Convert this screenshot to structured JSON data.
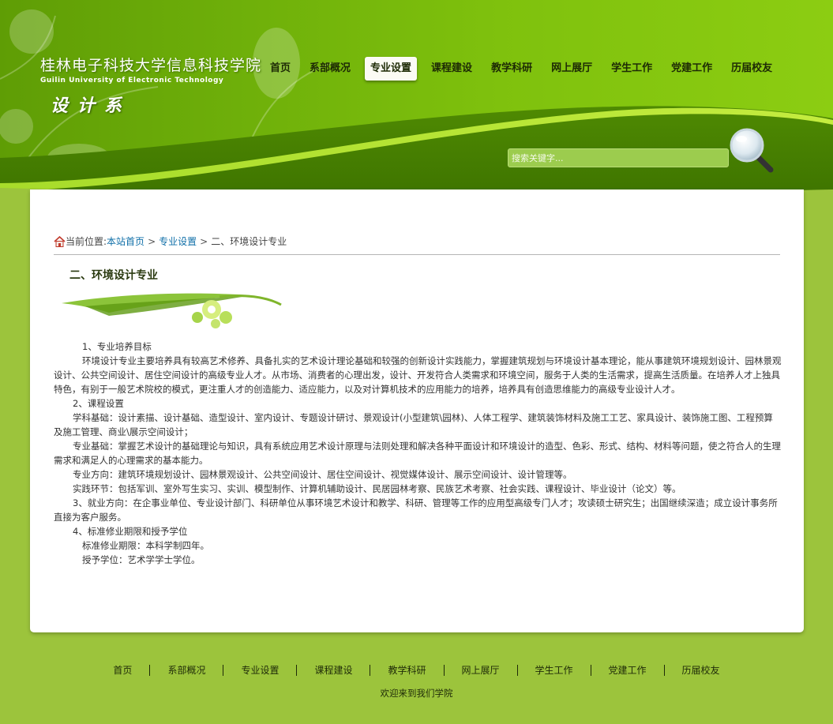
{
  "header": {
    "school_name": "桂林电子科技大学信息科技学院",
    "school_name_en": "Guilin University of Electronic Technology",
    "department": "设计系"
  },
  "nav": {
    "items": [
      {
        "label": "首页",
        "active": false
      },
      {
        "label": "系部概况",
        "active": false
      },
      {
        "label": "专业设置",
        "active": true
      },
      {
        "label": "课程建设",
        "active": false
      },
      {
        "label": "教学科研",
        "active": false
      },
      {
        "label": "网上展厅",
        "active": false
      },
      {
        "label": "学生工作",
        "active": false
      },
      {
        "label": "党建工作",
        "active": false
      },
      {
        "label": "历届校友",
        "active": false
      }
    ]
  },
  "search": {
    "placeholder": "搜索关键字...",
    "button_icon": "magnifier-icon"
  },
  "breadcrumb": {
    "prefix": "当前位置:",
    "home": "本站首页",
    "section": "专业设置",
    "current": "二、环境设计专业",
    "separator": ">"
  },
  "article": {
    "title": "二、环境设计专业",
    "paragraphs": [
      "1、专业培养目标",
      "环境设计专业主要培养具有较高艺术修养、具备扎实的艺术设计理论基础和较强的创新设计实践能力，掌握建筑规划与环境设计基本理论，能从事建筑环境规划设计、园林景观设计、公共空间设计、居住空间设计的高级专业人才。从市场、消费者的心理出发，设计、开发符合人类需求和环境空间，服务于人类的生活需求，提高生活质量。在培养人才上独具特色，有别于一般艺术院校的模式，更注重人才的创造能力、适应能力，以及对计算机技术的应用能力的培养，培养具有创造思维能力的高级专业设计人才。",
      "2、课程设置",
      "学科基础：设计素描、设计基础、造型设计、室内设计、专题设计研讨、景观设计(小型建筑\\园林)、人体工程学、建筑装饰材料及施工工艺、家具设计、装饰施工图、工程预算及施工管理、商业\\展示空间设计；",
      "专业基础：掌握艺术设计的基础理论与知识，具有系统应用艺术设计原理与法则处理和解决各种平面设计和环境设计的造型、色彩、形式、结构、材料等问题，使之符合人的生理需求和满足人的心理需求的基本能力。",
      "专业方向：建筑环境规划设计、园林景观设计、公共空间设计、居住空间设计、视觉媒体设计、展示空间设计、设计管理等。",
      "实践环节：包括军训、室外写生实习、实训、模型制作、计算机辅助设计、民居园林考察、民族艺术考察、社会实践、课程设计、毕业设计（论文）等。",
      "3、就业方向：在企事业单位、专业设计部门、科研单位从事环境艺术设计和教学、科研、管理等工作的应用型高级专门人才；攻读硕士研究生；出国继续深造；成立设计事务所直接为客户服务。",
      "4、标准修业期限和授予学位",
      "标准修业期限：本科学制四年。",
      "授予学位：艺术学学士学位。"
    ]
  },
  "footer": {
    "links": [
      "首页",
      "系部概况",
      "专业设置",
      "课程建设",
      "教学科研",
      "网上展厅",
      "学生工作",
      "党建工作",
      "历届校友"
    ],
    "welcome": "欢迎来到我们学院"
  },
  "colors": {
    "page_bg": "#9cc43c",
    "header_green": "#6fb00a",
    "link_blue": "#0f6fa8",
    "panel_bg": "#ffffff"
  }
}
